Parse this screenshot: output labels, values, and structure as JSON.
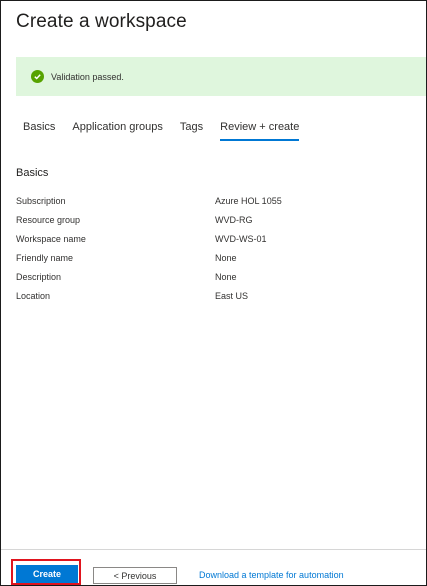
{
  "page": {
    "title": "Create a workspace"
  },
  "banner": {
    "message": "Validation passed.",
    "icon": "check-circle-icon",
    "color": "#57a300",
    "background": "#dff6dd"
  },
  "tabs": [
    {
      "label": "Basics",
      "active": false
    },
    {
      "label": "Application groups",
      "active": false
    },
    {
      "label": "Tags",
      "active": false
    },
    {
      "label": "Review + create",
      "active": true
    }
  ],
  "summary": {
    "section_title": "Basics",
    "rows": [
      {
        "label": "Subscription",
        "value": "Azure HOL 1055"
      },
      {
        "label": "Resource group",
        "value": "WVD-RG"
      },
      {
        "label": "Workspace name",
        "value": "WVD-WS-01"
      },
      {
        "label": "Friendly name",
        "value": "None"
      },
      {
        "label": "Description",
        "value": "None"
      },
      {
        "label": "Location",
        "value": "East US"
      }
    ]
  },
  "footer": {
    "create_label": "Create",
    "previous_label": "< Previous",
    "download_link": "Download a template for automation"
  },
  "colors": {
    "accent": "#0078d4",
    "highlight": "#e0141e"
  }
}
